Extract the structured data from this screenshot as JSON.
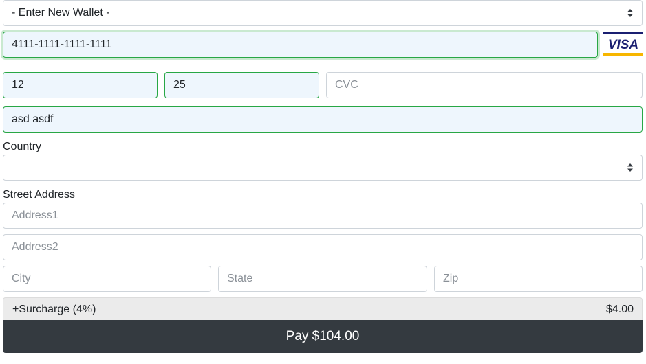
{
  "wallet": {
    "selected": "- Enter New Wallet -"
  },
  "card": {
    "number": "4111-1111-1111-1111",
    "brand_text": "VISA",
    "exp_month": "12",
    "exp_year": "25",
    "cvc_placeholder": "CVC",
    "name": "asd asdf"
  },
  "country": {
    "label": "Country",
    "selected": ""
  },
  "address": {
    "label": "Street Address",
    "address1_placeholder": "Address1",
    "address2_placeholder": "Address2",
    "city_placeholder": "City",
    "state_placeholder": "State",
    "zip_placeholder": "Zip"
  },
  "surcharge": {
    "label": "+Surcharge (4%)",
    "amount": "$4.00"
  },
  "pay_button": {
    "label": "Pay $104.00"
  },
  "colors": {
    "valid_border": "#28a745",
    "valid_fill": "#eef6fd",
    "pay_bg": "#343a40",
    "visa_blue": "#1a1f71",
    "visa_gold": "#f7b600"
  }
}
